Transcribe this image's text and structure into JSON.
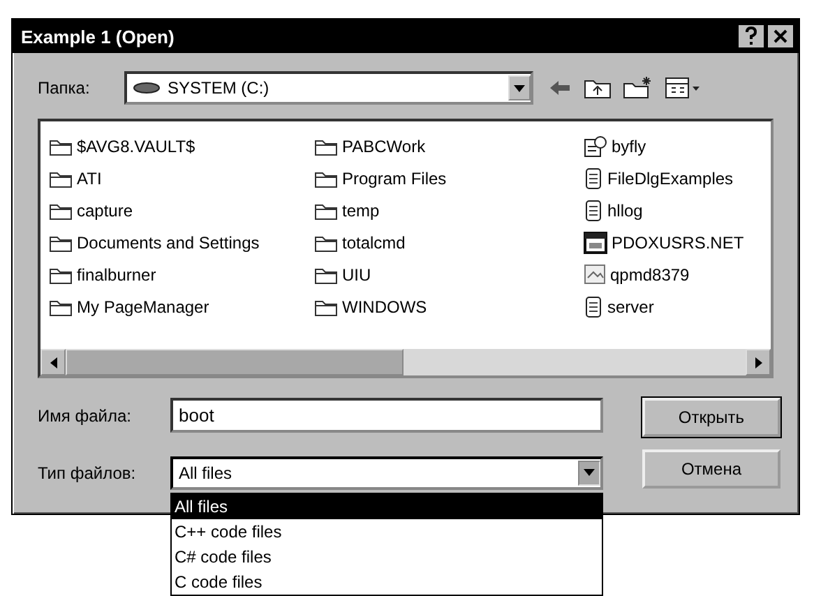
{
  "window": {
    "title": "Example 1 (Open)"
  },
  "look_in": {
    "label": "Папка:",
    "value": "SYSTEM (C:)"
  },
  "files": [
    {
      "name": "$AVG8.VAULT$",
      "kind": "folder"
    },
    {
      "name": "ATI",
      "kind": "folder"
    },
    {
      "name": "capture",
      "kind": "folder"
    },
    {
      "name": "Documents and Settings",
      "kind": "folder"
    },
    {
      "name": "finalburner",
      "kind": "folder"
    },
    {
      "name": "My PageManager",
      "kind": "folder"
    },
    {
      "name": "PABCWork",
      "kind": "folder"
    },
    {
      "name": "Program Files",
      "kind": "folder"
    },
    {
      "name": "temp",
      "kind": "folder"
    },
    {
      "name": "totalcmd",
      "kind": "folder"
    },
    {
      "name": "UIU",
      "kind": "folder"
    },
    {
      "name": "WINDOWS",
      "kind": "folder"
    },
    {
      "name": "byfly",
      "kind": "network"
    },
    {
      "name": "FileDlgExamples",
      "kind": "text"
    },
    {
      "name": "hllog",
      "kind": "text"
    },
    {
      "name": "PDOXUSRS.NET",
      "kind": "window"
    },
    {
      "name": "qpmd8379",
      "kind": "image"
    },
    {
      "name": "server",
      "kind": "text"
    }
  ],
  "file_name": {
    "label": "Имя файла:",
    "value": "boot"
  },
  "file_type": {
    "label": "Тип файлов:",
    "value": "All files",
    "expanded": true,
    "options": [
      {
        "label": "All files",
        "selected": true
      },
      {
        "label": "C++ code files",
        "selected": false
      },
      {
        "label": "C# code files",
        "selected": false
      },
      {
        "label": "C code files",
        "selected": false
      }
    ]
  },
  "buttons": [
    {
      "label": "Открыть",
      "default": true
    },
    {
      "label": "Отмена",
      "default": false
    }
  ]
}
